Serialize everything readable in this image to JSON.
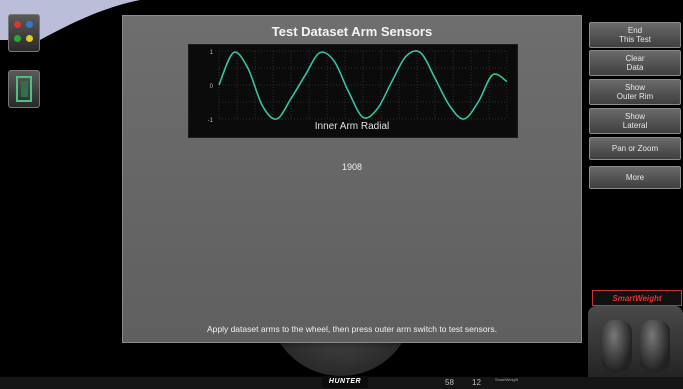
{
  "dialog": {
    "title": "Test Dataset Arm Sensors",
    "plot_label": "Inner Arm Radial",
    "value": "1908",
    "instruction": "Apply dataset arms to the wheel, then press outer arm switch to test sensors."
  },
  "chart_data": {
    "type": "line",
    "series": [
      {
        "x": [
          0,
          45,
          90,
          135,
          180,
          225,
          270,
          315,
          360,
          405,
          450,
          495,
          540,
          585,
          630,
          675,
          720,
          765,
          810,
          855,
          900
        ],
        "y": [
          0,
          0.95,
          0.5,
          -0.6,
          -1,
          -0.4,
          0.3,
          0.95,
          0.7,
          -0.2,
          -0.95,
          -0.7,
          0.1,
          0.85,
          0.95,
          0.2,
          -0.6,
          -1,
          -0.5,
          0.3,
          0.1
        ]
      }
    ],
    "xlim": [
      0,
      900
    ],
    "ylim": [
      -1,
      1
    ],
    "y_ticks": [
      "-1",
      "0",
      "1"
    ],
    "grid": true
  },
  "right_buttons": [
    {
      "label": "End\nThis Test"
    },
    {
      "label": "Clear\nData"
    },
    {
      "label": "Show\nOuter Rim"
    },
    {
      "label": "Show\nLateral"
    },
    {
      "label": "Pan or Zoom"
    },
    {
      "label": "More"
    }
  ],
  "brand": {
    "smartweight": "SmartWeight",
    "hunter": "HUNTER",
    "readout_left": "58",
    "readout_right": "12",
    "smartweight_footer": "SmartWeight"
  },
  "colors": {
    "trace": "#35c3a3",
    "dialog": "#656565",
    "accent": "#e53030"
  },
  "icons": {
    "lights": "indicator-lights-icon",
    "door": "door-exit-icon"
  }
}
